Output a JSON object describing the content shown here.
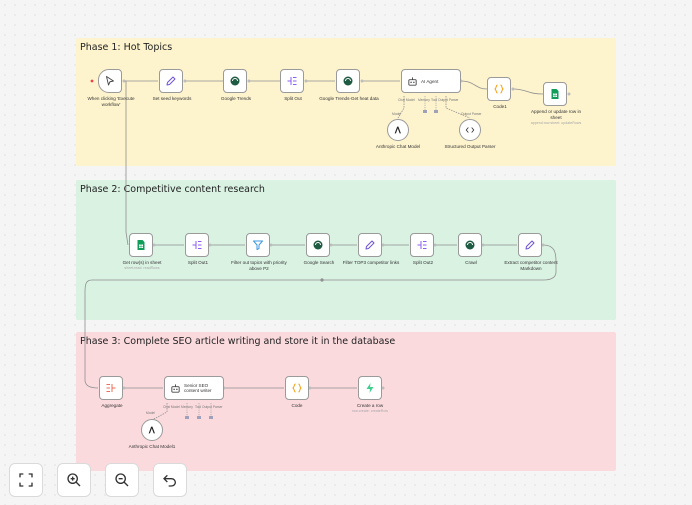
{
  "sections": {
    "phase1": {
      "title": "Phase 1: Hot Topics",
      "color": "#fdf3cd"
    },
    "phase2": {
      "title": "Phase 2: Competitive content research",
      "color": "#d9f2e2"
    },
    "phase3": {
      "title": "Phase 3: Complete SEO article writing and store it in the database",
      "color": "#fbdadd"
    }
  },
  "nodes": {
    "trigger": {
      "label": "When clicking 'Execute workflow'",
      "icon": "cursor-icon"
    },
    "set_seed": {
      "label": "Set seed keywords",
      "icon": "pencil-icon"
    },
    "google_trends": {
      "label": "Google Trends",
      "icon": "serpapi-icon"
    },
    "split_out": {
      "label": "Split Out",
      "icon": "split-icon"
    },
    "trends_heat": {
      "label": "Google Trends-Get heat data",
      "icon": "serpapi-icon"
    },
    "ai_agent": {
      "label": "AI Agent",
      "icon": "robot-icon",
      "ports": [
        "Chat Model",
        "Memory",
        "Tool",
        "Output Parser"
      ]
    },
    "code1": {
      "label": "Code1",
      "icon": "braces-icon"
    },
    "append_row": {
      "label": "Append or update row in sheet",
      "sublabel": "append:row:sheet: updateRows",
      "icon": "sheets-icon"
    },
    "anthropic1": {
      "label": "Anthropic Chat Model",
      "icon": "anthropic-icon",
      "port": "Model"
    },
    "structured_parser": {
      "label": "Structured Output Parser",
      "icon": "code-icon",
      "port": "Output Parser"
    },
    "get_rows": {
      "label": "Get row(s) in sheet",
      "sublabel": "sheet:read: readRows",
      "icon": "sheets-icon"
    },
    "split_out1": {
      "label": "Split Out1",
      "icon": "split-icon"
    },
    "filter_topics": {
      "label": "Filter out topics with priority above P2",
      "icon": "filter-icon"
    },
    "google_search": {
      "label": "Google Search",
      "icon": "serpapi-icon"
    },
    "filter_top3": {
      "label": "Filter TOP3 competitor links",
      "icon": "pencil-icon"
    },
    "split_out2": {
      "label": "Split Out2",
      "icon": "split-icon"
    },
    "crawl": {
      "label": "Crawl",
      "icon": "serpapi-icon"
    },
    "extract_md": {
      "label": "Extract competitor content Markdown",
      "icon": "pencil-icon"
    },
    "aggregate": {
      "label": "Aggregate",
      "icon": "aggregate-icon"
    },
    "seo_writer": {
      "label": "Senior SEO content writer",
      "icon": "robot-icon",
      "ports": [
        "Chat Model",
        "Memory",
        "Tool",
        "Output Parser"
      ]
    },
    "code": {
      "label": "Code",
      "icon": "braces-icon"
    },
    "create_row": {
      "label": "Create a row",
      "sublabel": "row:create: createRow",
      "icon": "supabase-icon"
    },
    "anthropic2": {
      "label": "Anthropic Chat Model1",
      "icon": "anthropic-icon",
      "port": "Model"
    }
  },
  "toolbar": [
    "fit-view-icon",
    "zoom-in-icon",
    "zoom-out-icon",
    "undo-icon"
  ],
  "colors": {
    "wire": "#8f8f8f",
    "sheets": "#0f9d58",
    "supabase": "#3ecf8e",
    "pencil": "#6f52d6",
    "braces": "#f59e0b",
    "split": "#8b5cf6",
    "filter": "#3b9ae0",
    "aggregate": "#ef6c5a"
  }
}
